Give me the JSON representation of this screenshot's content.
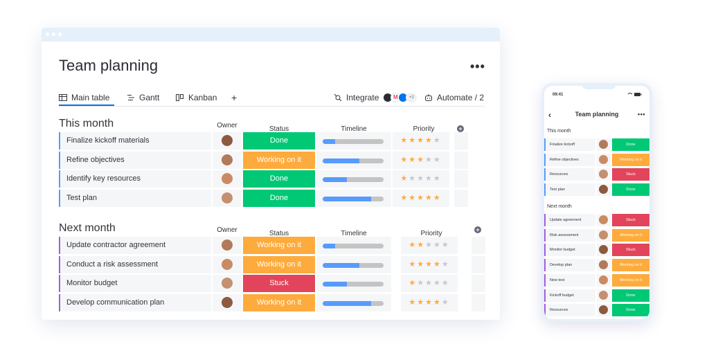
{
  "board": {
    "title": "Team planning",
    "more": "•••",
    "tabs": [
      {
        "label": "Main table",
        "icon": "table-icon"
      },
      {
        "label": "Gantt",
        "icon": "gantt-icon"
      },
      {
        "label": "Kanban",
        "icon": "kanban-icon"
      },
      {
        "label": "+",
        "icon": "add-view-icon"
      }
    ],
    "integrate_label": "Integrate",
    "integrate_extra": "+2",
    "automate_label": "Automate / 2",
    "columns": {
      "owner": "Owner",
      "status": "Status",
      "timeline": "Timeline",
      "priority": "Priority"
    },
    "groups": [
      {
        "title": "This month",
        "color": "#579bfc",
        "rows": [
          {
            "name": "Finalize kickoff materials",
            "status": "Done",
            "status_color": "#00c875",
            "timeline": 0.2,
            "priority": 4
          },
          {
            "name": "Refine objectives",
            "status": "Working on it",
            "status_color": "#fdab3d",
            "timeline": 0.6,
            "priority": 3
          },
          {
            "name": "Identify key resources",
            "status": "Done",
            "status_color": "#00c875",
            "timeline": 0.4,
            "priority": 1
          },
          {
            "name": "Test plan",
            "status": "Done",
            "status_color": "#00c875",
            "timeline": 0.8,
            "priority": 5
          }
        ]
      },
      {
        "title": "Next month",
        "color": "#a25ddc",
        "rows": [
          {
            "name": "Update contractor agreement",
            "status": "Working on it",
            "status_color": "#fdab3d",
            "timeline": 0.2,
            "priority": 2
          },
          {
            "name": "Conduct a risk assessment",
            "status": "Working on it",
            "status_color": "#fdab3d",
            "timeline": 0.6,
            "priority": 4
          },
          {
            "name": "Monitor budget",
            "status": "Stuck",
            "status_color": "#e2445c",
            "timeline": 0.4,
            "priority": 1
          },
          {
            "name": "Develop communication plan",
            "status": "Working on it",
            "status_color": "#fdab3d",
            "timeline": 0.8,
            "priority": 4
          }
        ]
      }
    ]
  },
  "phone": {
    "time": "09:41",
    "title": "Team planning",
    "more": "•••",
    "groups": [
      {
        "title": "This month",
        "color": "#579bfc",
        "rows": [
          {
            "name": "Finalize kickoff",
            "status": "Done",
            "status_color": "#00c875"
          },
          {
            "name": "Refine objectives",
            "status": "Working on it",
            "status_color": "#fdab3d"
          },
          {
            "name": "Resources",
            "status": "Stuck",
            "status_color": "#e2445c"
          },
          {
            "name": "Test plan",
            "status": "Done",
            "status_color": "#00c875"
          }
        ]
      },
      {
        "title": "Next month",
        "color": "#a25ddc",
        "rows": [
          {
            "name": "Update agreement",
            "status": "Stuck",
            "status_color": "#e2445c"
          },
          {
            "name": "Risk assessment",
            "status": "Working on it",
            "status_color": "#fdab3d"
          },
          {
            "name": "Monitor budget",
            "status": "Stuck",
            "status_color": "#e2445c"
          },
          {
            "name": "Develop plan",
            "status": "Working on it",
            "status_color": "#fdab3d"
          },
          {
            "name": "New test",
            "status": "Working on it",
            "status_color": "#fdab3d"
          },
          {
            "name": "Kickoff budget",
            "status": "Done",
            "status_color": "#00c875"
          },
          {
            "name": "Resources",
            "status": "Done",
            "status_color": "#00c875"
          }
        ]
      }
    ]
  }
}
